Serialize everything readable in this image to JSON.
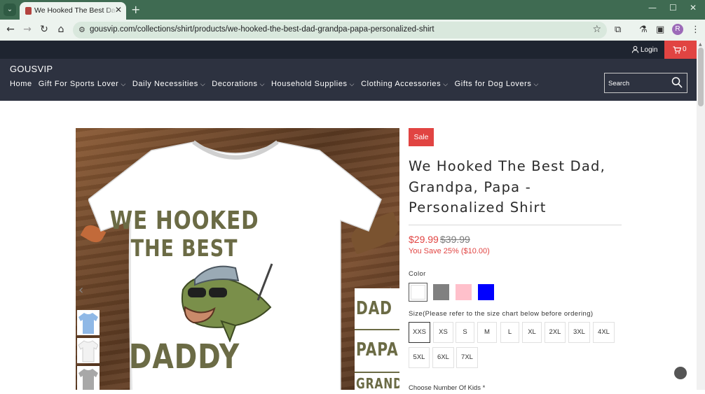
{
  "browser": {
    "tab_title": "We Hooked The Best Dad, Grandpa",
    "tab_close": "✕",
    "new_tab": "+",
    "url": "gousvip.com/collections/shirt/products/we-hooked-the-best-dad-grandpa-papa-personalized-shirt",
    "profile_initial": "R",
    "icons": [
      "tab-list-icon",
      "back-icon",
      "forward-icon",
      "reload-icon",
      "home-icon",
      "site-info-icon",
      "bookmark-star-icon",
      "extensions-icon",
      "labs-icon",
      "side-panel-icon",
      "menu-icon",
      "minimize-icon",
      "maximize-icon",
      "close-icon"
    ]
  },
  "header": {
    "login": "Login",
    "cart_count": "0",
    "brand": "GOUSVIP",
    "search_placeholder": "Search",
    "menu": [
      {
        "label": "Home",
        "dropdown": false
      },
      {
        "label": "Gift For Sports Lover",
        "dropdown": true
      },
      {
        "label": "Daily Necessities",
        "dropdown": true
      },
      {
        "label": "Decorations",
        "dropdown": true
      },
      {
        "label": "Household Supplies",
        "dropdown": true
      },
      {
        "label": "Clothing Accessories",
        "dropdown": true
      },
      {
        "label": "Gifts for Dog Lovers",
        "dropdown": true
      }
    ]
  },
  "product": {
    "badge": "Sale",
    "title": "We Hooked The Best Dad, Grandpa, Papa - Personalized Shirt",
    "price": "$29.99",
    "compare_price": "$39.99",
    "savings": "You Save 25% ($10.00)",
    "color_label": "Color",
    "colors": [
      {
        "name": "white",
        "hex": "#ffffff",
        "selected": true
      },
      {
        "name": "gray",
        "hex": "#808080",
        "selected": false
      },
      {
        "name": "pink",
        "hex": "#ffc0cb",
        "selected": false
      },
      {
        "name": "blue",
        "hex": "#0000ff",
        "selected": false
      }
    ],
    "size_label": "Size(Please refer to the size chart below before ordering)",
    "sizes": [
      "XXS",
      "XS",
      "S",
      "M",
      "L",
      "XL",
      "2XL",
      "3XL",
      "4XL",
      "5XL",
      "6XL",
      "7XL"
    ],
    "selected_size": "XXS",
    "next_label_partial": "Choose Number Of Kids *"
  },
  "gallery": {
    "slogan_line1": "WE HOOKED",
    "slogan_line2": "THE BEST",
    "slogan_line3": "DADDY",
    "side_words": [
      "DAD",
      "PAPA",
      "GRANDP"
    ],
    "thumb_colors": [
      "#8fb8e6",
      "#f2f2f2",
      "#a8a8a8"
    ]
  },
  "colors": {
    "accent": "#e14442",
    "dark_header": "#1e2430",
    "nav_bg": "#2d3240",
    "chrome": "#3f6b52"
  }
}
